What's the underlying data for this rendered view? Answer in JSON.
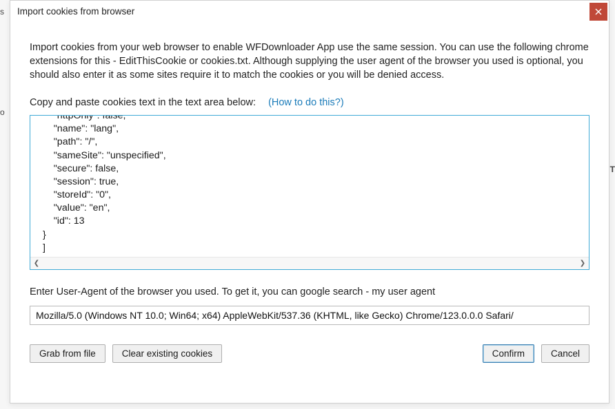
{
  "dialog": {
    "title": "Import cookies from browser",
    "intro": "Import cookies from your web browser to enable WFDownloader App use the same session. You can use the following chrome extensions for this - EditThisCookie or cookies.txt. Although supplying the user agent of the browser you used is optional, you should also enter it as some sites require it to match the cookies or you will be denied access.",
    "cookies_label": "Copy and paste cookies text in the text area below:",
    "howto_link": "(How to do this?)",
    "cookies_textarea_value": "    \"httpOnly\": false,\n    \"name\": \"lang\",\n    \"path\": \"/\",\n    \"sameSite\": \"unspecified\",\n    \"secure\": false,\n    \"session\": true,\n    \"storeId\": \"0\",\n    \"value\": \"en\",\n    \"id\": 13\n}\n]",
    "user_agent_label": "Enter User-Agent of the browser you used. To get it, you can google search - my user agent",
    "user_agent_value": "Mozilla/5.0 (Windows NT 10.0; Win64; x64) AppleWebKit/537.36 (KHTML, like Gecko) Chrome/123.0.0.0 Safari/",
    "buttons": {
      "grab_from_file": "Grab from file",
      "clear_existing": "Clear existing cookies",
      "confirm": "Confirm",
      "cancel": "Cancel"
    }
  },
  "colors": {
    "close_button_bg": "#c04838",
    "link_color": "#1a7bb9",
    "textarea_border_focus": "#3fa9d6",
    "button_primary_border": "#3c7fb1"
  }
}
